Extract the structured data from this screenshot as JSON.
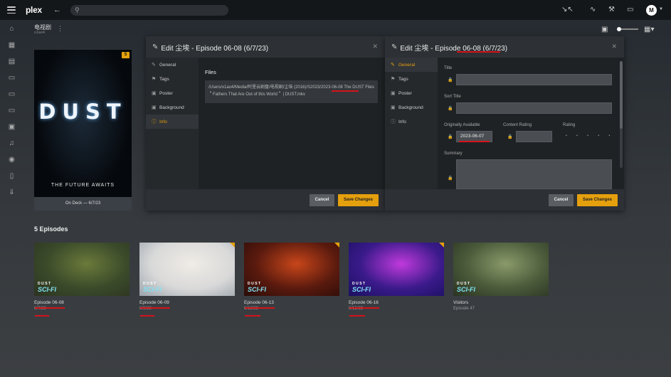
{
  "app": {
    "logo_text": "plex",
    "logo_accent": "x",
    "search_placeholder": ""
  },
  "topbar": {
    "icons": [
      "fullscreen-exit-icon",
      "activity-icon",
      "tools-icon",
      "cast-icon"
    ],
    "avatar_initial": "M"
  },
  "sidebar": {
    "icons": [
      "home-icon",
      "movies-icon",
      "film-icon",
      "tv-icon",
      "monitor-icon",
      "tv-icon",
      "radio-icon",
      "music-icon",
      "camera-icon",
      "bookmark-icon",
      "download-icon"
    ]
  },
  "library": {
    "name": "电视剧",
    "subtitle": "x1ao4"
  },
  "poster": {
    "title": "DUST",
    "tagline": "THE FUTURE AWAITS",
    "badge": "5",
    "on_deck": "On Deck — 6/7/23"
  },
  "dialog_info": {
    "title": "Edit 尘埃 - Episode 06-08 (6/7/23)",
    "nav": [
      {
        "label": "General",
        "icon": "pencil-icon"
      },
      {
        "label": "Tags",
        "icon": "tag-icon"
      },
      {
        "label": "Poster",
        "icon": "image-icon"
      },
      {
        "label": "Background",
        "icon": "image-icon"
      },
      {
        "label": "Info",
        "icon": "info-icon"
      }
    ],
    "files_heading": "Files",
    "file_path": "/Users/x1ao4/Media/阿里云剧盘/电视剧/尘埃 (2016)/S2023/2023-06-08 The DUST Files ＂Fathers That Are Out of this World＂ | DUST.mkv",
    "cancel": "Cancel",
    "save": "Save Changes"
  },
  "dialog_general": {
    "title": "Edit 尘埃 - Episode 06-08 (6/7/23)",
    "nav": [
      {
        "label": "General",
        "icon": "pencil-icon"
      },
      {
        "label": "Tags",
        "icon": "tag-icon"
      },
      {
        "label": "Poster",
        "icon": "image-icon"
      },
      {
        "label": "Background",
        "icon": "image-icon"
      },
      {
        "label": "Info",
        "icon": "info-icon"
      }
    ],
    "fields": {
      "title_label": "Title",
      "title_value": "",
      "sort_title_label": "Sort Title",
      "sort_title_value": "",
      "originally_available_label": "Originally Available",
      "originally_available_value": "2023-06-07",
      "content_rating_label": "Content Rating",
      "content_rating_value": "",
      "rating_label": "Rating",
      "rating_stars": "• • • • •",
      "summary_label": "Summary",
      "summary_value": ""
    },
    "cancel": "Cancel",
    "save": "Save Changes"
  },
  "episodes": {
    "heading": "5 Episodes",
    "items": [
      {
        "title": "Episode 06-08",
        "subtitle": "6/7/23",
        "brand": "DUST",
        "series_tag": "SCI-FI",
        "colors": [
          "#3a4a2a",
          "#6b7a3a",
          "#2c3320"
        ]
      },
      {
        "title": "Episode 06-09",
        "subtitle": "6/8/23",
        "brand": "DUST",
        "series_tag": "SCI-FI",
        "colors": [
          "#d9d9d9",
          "#f0ece6",
          "#9aa3ab"
        ]
      },
      {
        "title": "Episode 06-13",
        "subtitle": "6/12/23",
        "brand": "DUST",
        "series_tag": "SCI-FI",
        "colors": [
          "#5a1a0e",
          "#c8461a",
          "#2a0c08"
        ]
      },
      {
        "title": "Episode 06-16",
        "subtitle": "6/15/23",
        "brand": "DUST",
        "series_tag": "SCI-FI",
        "colors": [
          "#3a1a8a",
          "#c03adc",
          "#1a1060"
        ]
      },
      {
        "title": "Visitors",
        "subtitle": "Episode 47",
        "brand": "DUST",
        "series_tag": "SCI-FI",
        "colors": [
          "#4a5a3a",
          "#8a9a6a",
          "#2a3322"
        ]
      }
    ]
  },
  "colors": {
    "accent": "#e5a00d",
    "annotation": "#d4131b"
  }
}
